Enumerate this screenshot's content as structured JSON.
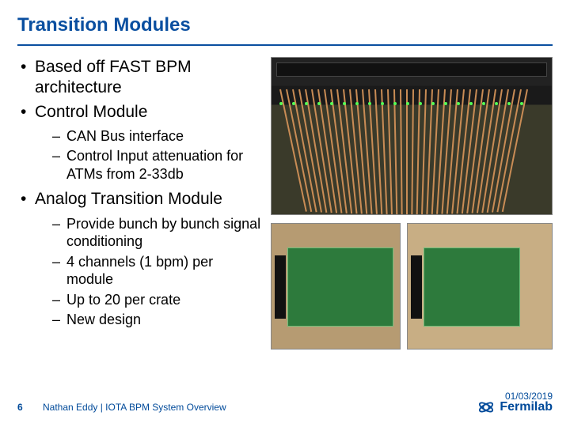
{
  "title": "Transition Modules",
  "bullets": [
    {
      "text": "Based off FAST BPM architecture"
    },
    {
      "text": "Control Module",
      "sub": [
        "CAN Bus interface",
        "Control Input attenuation for ATMs from 2-33db"
      ]
    },
    {
      "text": "Analog Transition Module",
      "sub": [
        "Provide bunch by bunch signal conditioning",
        "4 channels (1 bpm) per module",
        "Up to 20 per crate",
        "New design"
      ]
    }
  ],
  "footer": {
    "page": "6",
    "attribution": "Nathan Eddy | IOTA BPM System Overview",
    "date": "01/03/2019",
    "brand": "Fermilab"
  }
}
